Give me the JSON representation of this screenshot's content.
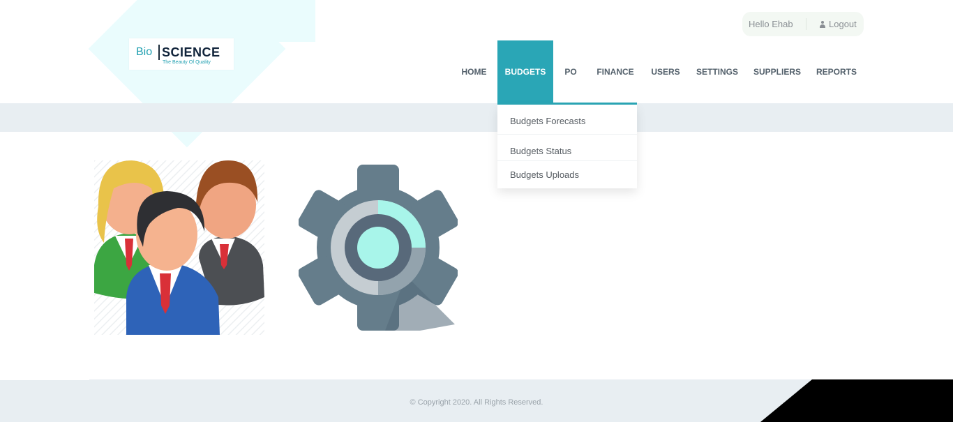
{
  "brand": {
    "name_left": "Bio",
    "name_right": "SCIENCE",
    "tagline": "The Beauty Of Quality"
  },
  "user": {
    "greeting": "Hello Ehab",
    "logout_label": "Logout"
  },
  "nav": {
    "items": [
      {
        "label": "HOME"
      },
      {
        "label": "BUDGETS",
        "active": true
      },
      {
        "label": "PO"
      },
      {
        "label": "FINANCE"
      },
      {
        "label": "USERS"
      },
      {
        "label": "SETTINGS"
      },
      {
        "label": "SUPPLIERS"
      },
      {
        "label": "REPORTS"
      }
    ]
  },
  "budgets_menu": {
    "items": [
      {
        "label": "Budgets Forecasts"
      },
      {
        "label": "Budgets Status"
      },
      {
        "label": "Budgets Uploads"
      }
    ]
  },
  "tiles": [
    {
      "icon": "users-group-icon"
    },
    {
      "icon": "settings-gear-icon"
    }
  ],
  "footer": {
    "copyright": "© Copyright 2020. All Rights Reserved."
  },
  "colors": {
    "accent": "#2aa6b6",
    "band": "#e8eef2",
    "gear": "#657d8b",
    "gear_center": "#a8f5ea"
  }
}
